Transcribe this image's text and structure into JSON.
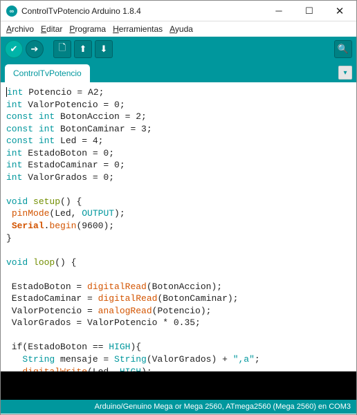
{
  "window": {
    "title": "ControlTvPotencio Arduino 1.8.4"
  },
  "menu": {
    "archivo": "Archivo",
    "editar": "Editar",
    "programa": "Programa",
    "herramientas": "Herramientas",
    "ayuda": "Ayuda"
  },
  "tab": {
    "name": "ControlTvPotencio"
  },
  "code": {
    "l1_a": "int",
    "l1_b": " Potencio = A2;",
    "l2_a": "int",
    "l2_b": " ValorPotencio = 0;",
    "l3_a": "const",
    "l3_b": " ",
    "l3_c": "int",
    "l3_d": " BotonAccion = 2;",
    "l4_a": "const",
    "l4_b": " ",
    "l4_c": "int",
    "l4_d": " BotonCaminar = 3;",
    "l5_a": "const",
    "l5_b": " ",
    "l5_c": "int",
    "l5_d": " Led = 4;",
    "l6_a": "int",
    "l6_b": " EstadoBoton = 0;",
    "l7_a": "int",
    "l7_b": " EstadoCaminar = 0;",
    "l8_a": "int",
    "l8_b": " ValorGrados = 0;",
    "blank": "",
    "l10_a": "void",
    "l10_b": " ",
    "l10_c": "setup",
    "l10_d": "() {",
    "l11_a": " ",
    "l11_b": "pinMode",
    "l11_c": "(Led, ",
    "l11_d": "OUTPUT",
    "l11_e": ");",
    "l12_a": " ",
    "l12_b": "Serial",
    "l12_c": ".",
    "l12_d": "begin",
    "l12_e": "(9600);",
    "l13": "}",
    "l15_a": "void",
    "l15_b": " ",
    "l15_c": "loop",
    "l15_d": "() {",
    "l17_a": " EstadoBoton = ",
    "l17_b": "digitalRead",
    "l17_c": "(BotonAccion);",
    "l18_a": " EstadoCaminar = ",
    "l18_b": "digitalRead",
    "l18_c": "(BotonCaminar);",
    "l19_a": " ValorPotencio = ",
    "l19_b": "analogRead",
    "l19_c": "(Potencio);",
    "l20": " ValorGrados = ValorPotencio * 0.35;",
    "l22_a": " if(EstadoBoton == ",
    "l22_b": "HIGH",
    "l22_c": "){",
    "l23_a": "   ",
    "l23_b": "String",
    "l23_c": " mensaje = ",
    "l23_d": "String",
    "l23_e": "(ValorGrados) + ",
    "l23_f": "\",a\"",
    "l23_g": ";",
    "l24_a": "   ",
    "l24_b": "digitalWrite",
    "l24_c": "(Led, ",
    "l24_d": "HIGH",
    "l24_e": ");"
  },
  "status": {
    "text": "Arduino/Genuino Mega or Mega 2560, ATmega2560 (Mega 2560) en COM3"
  }
}
